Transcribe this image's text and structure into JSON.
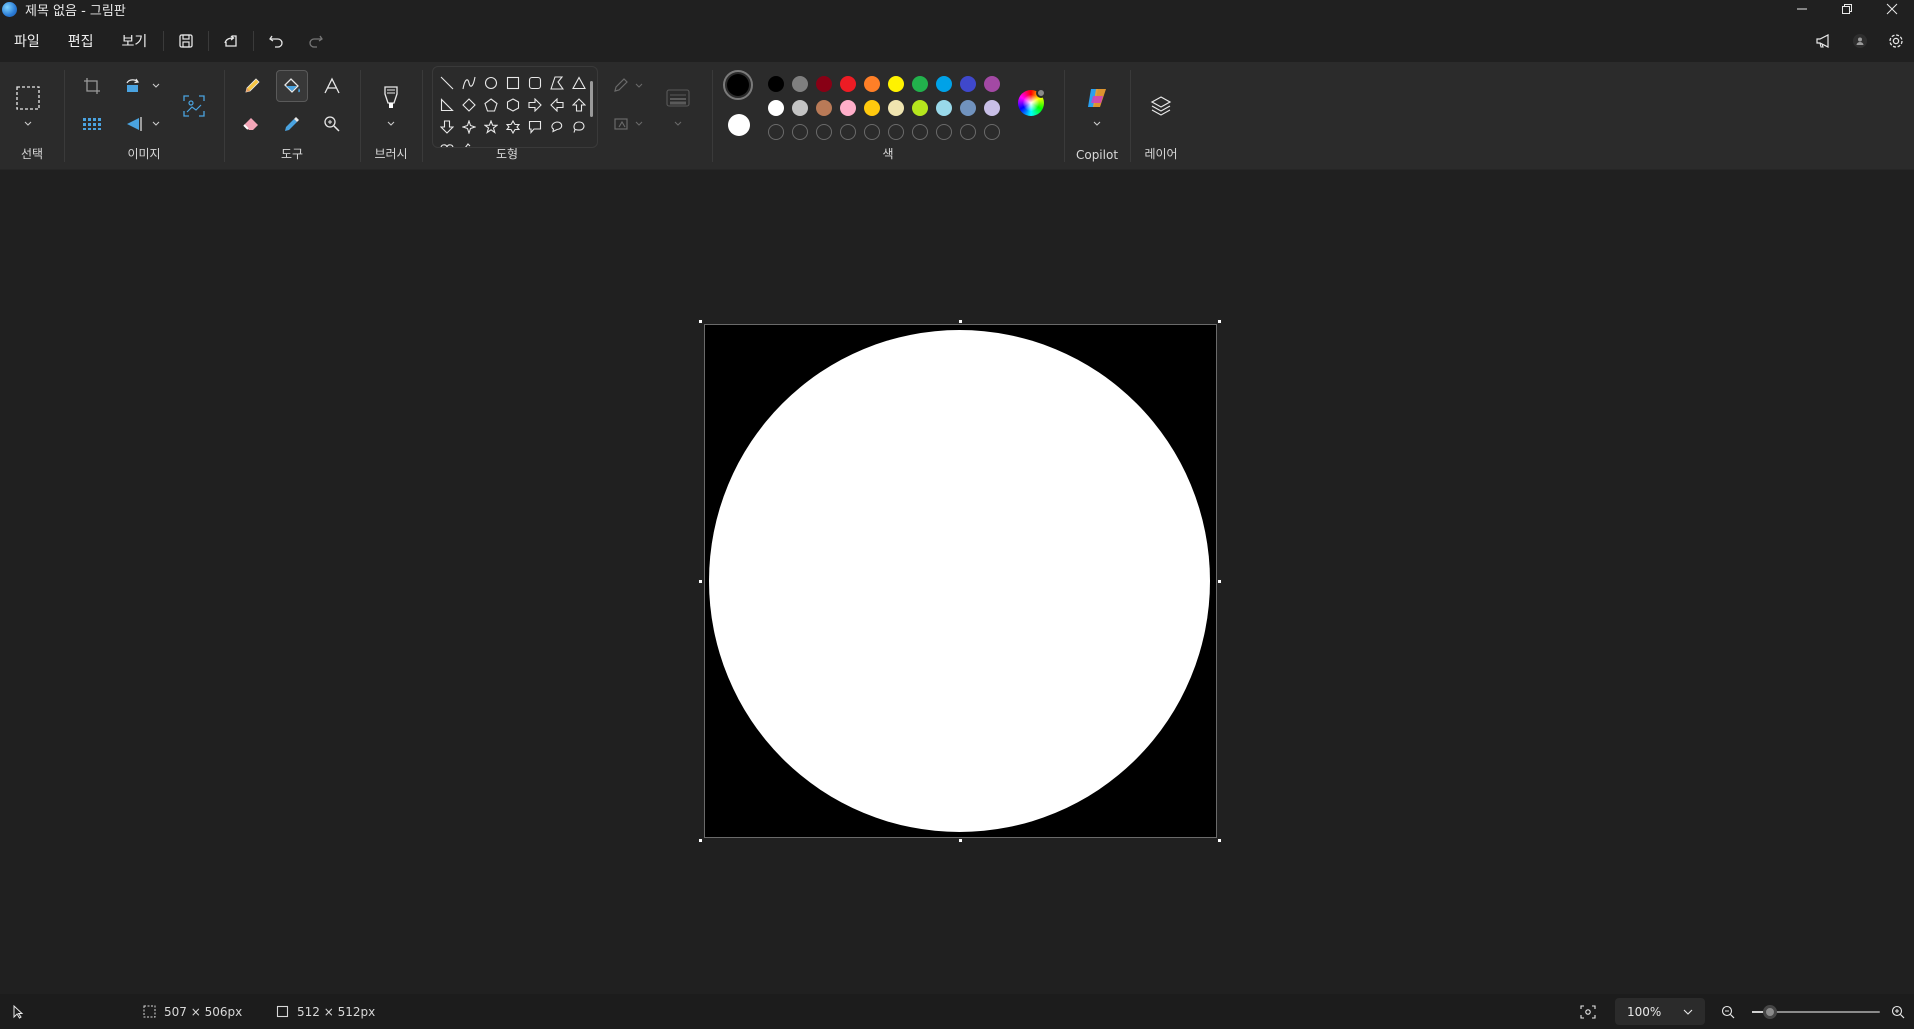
{
  "window": {
    "title": "제목 없음 - 그림판",
    "app_icon": "paint-globe-icon",
    "controls": [
      "minimize-icon",
      "restore-icon",
      "close-icon"
    ]
  },
  "menu": {
    "items": [
      "파일",
      "편집",
      "보기"
    ],
    "quick_actions": [
      "save-icon",
      "share-icon",
      "undo-icon",
      "redo-icon"
    ],
    "right_icons": [
      "announcement-icon",
      "account-icon",
      "settings-icon"
    ]
  },
  "ribbon": {
    "groups": {
      "select": "선택",
      "image": "이미지",
      "tools": "도구",
      "brushes": "브러시",
      "shapes": "도형",
      "colors": "색",
      "copilot": "Copilot",
      "layers": "레이어"
    },
    "active_tool": "fill-bucket",
    "primary_color": "#000000",
    "secondary_color": "#ffffff",
    "palette_row1": [
      "#000000",
      "#7f7f7f",
      "#880015",
      "#ed1c24",
      "#ff7f27",
      "#fff200",
      "#22b14c",
      "#00a2e8",
      "#3f48cc",
      "#a349a4"
    ],
    "palette_row2": [
      "#ffffff",
      "#c3c3c3",
      "#b97a57",
      "#ffaec9",
      "#ffc90e",
      "#efe4b0",
      "#b5e61d",
      "#99d9ea",
      "#7092be",
      "#c8bfe7"
    ],
    "palette_row3_custom_slots": 10
  },
  "canvas": {
    "background": "#000000",
    "shape": "white circle"
  },
  "status": {
    "selection_size": "507 × 506px",
    "canvas_size": "512 × 512px",
    "zoom": "100%",
    "zoom_level": 0.14
  }
}
